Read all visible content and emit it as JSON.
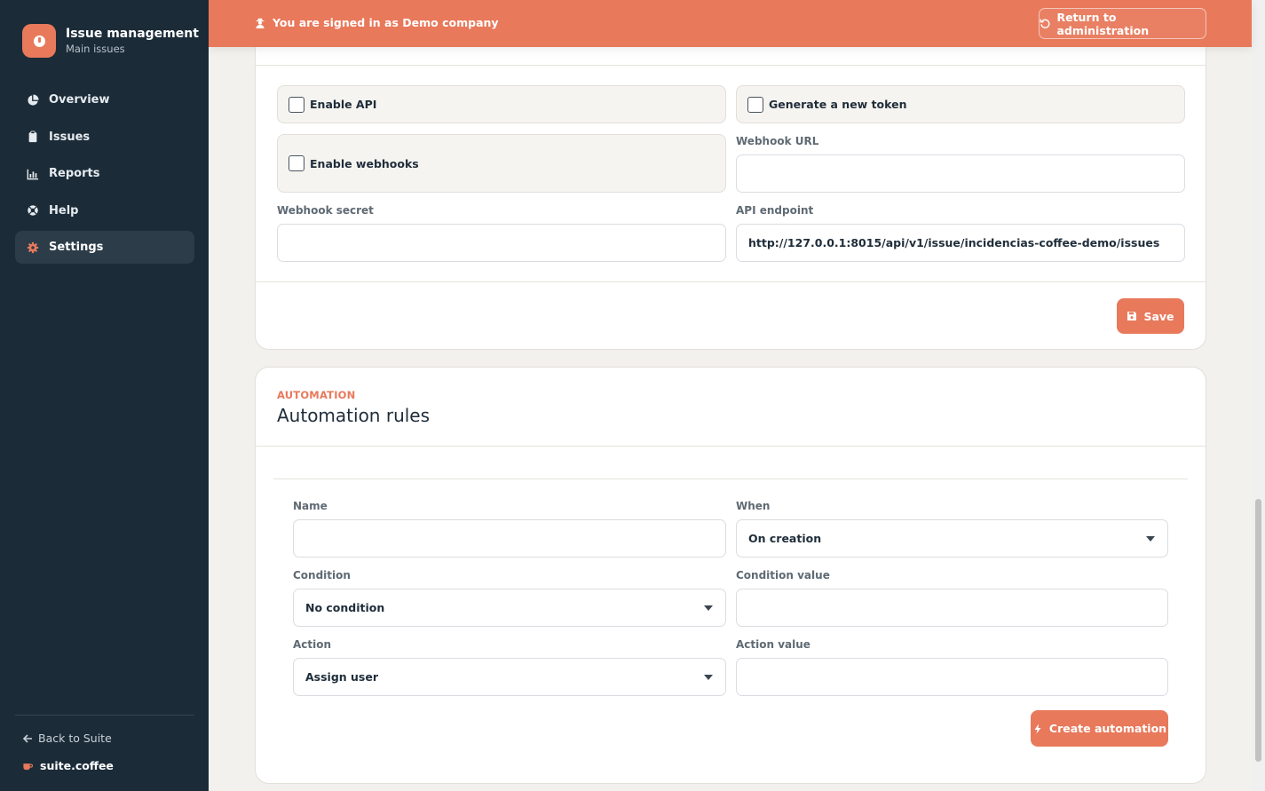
{
  "sidebar": {
    "brand_title": "Issue management",
    "brand_subtitle": "Main issues",
    "items": [
      {
        "label": "Overview",
        "icon": "pie-chart-icon"
      },
      {
        "label": "Issues",
        "icon": "clipboard-icon"
      },
      {
        "label": "Reports",
        "icon": "bar-chart-icon"
      },
      {
        "label": "Help",
        "icon": "lifebuoy-icon"
      },
      {
        "label": "Settings",
        "icon": "gear-icon",
        "active": true
      }
    ],
    "back_label": "Back to Suite",
    "suite_label": "suite.coffee"
  },
  "banner": {
    "text": "You are signed in as Demo company",
    "return_label": "Return to administration"
  },
  "api_settings": {
    "enable_api_label": "Enable API",
    "enable_api_checked": false,
    "new_token_label": "Generate a new token",
    "new_token_checked": false,
    "enable_webhooks_label": "Enable webhooks",
    "enable_webhooks_checked": false,
    "webhook_url_label": "Webhook URL",
    "webhook_url_value": "",
    "webhook_secret_label": "Webhook secret",
    "webhook_secret_value": "",
    "api_endpoint_label": "API endpoint",
    "api_endpoint_value": "http://127.0.0.1:8015/api/v1/issue/incidencias-coffee-demo/issues",
    "save_label": "Save"
  },
  "automation": {
    "eyebrow": "AUTOMATION",
    "title": "Automation rules",
    "name_label": "Name",
    "name_value": "",
    "when_label": "When",
    "when_value": "On creation",
    "condition_label": "Condition",
    "condition_value_selected": "No condition",
    "condition_value_label": "Condition value",
    "condition_value_input": "",
    "action_label": "Action",
    "action_selected": "Assign user",
    "action_value_label": "Action value",
    "action_value_input": "",
    "create_label": "Create automation"
  },
  "colors": {
    "accent": "#e8795b",
    "sidebar_bg": "#1b2b38",
    "page_bg": "#f3f1ed"
  }
}
